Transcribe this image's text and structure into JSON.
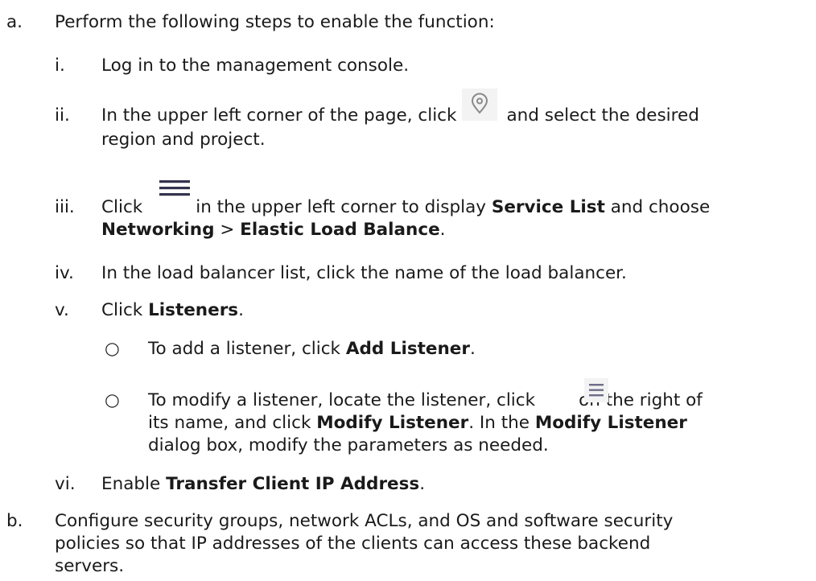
{
  "step_a": {
    "marker": "a.",
    "text": "Perform the following steps to enable the function:",
    "substeps": {
      "i": {
        "marker": "i.",
        "text": "Log in to the management console."
      },
      "ii": {
        "marker": "ii.",
        "line1_before": "In the upper left corner of the page, click",
        "line1_after": "and select the desired",
        "line2": "region and project.",
        "icon": "location-pin-icon"
      },
      "iii": {
        "marker": "iii.",
        "line1_before": "Click",
        "line1_mid": "in the upper left corner to display",
        "bold_service_list": "Service List",
        "line1_after": "and choose",
        "bold_networking": "Networking",
        "sep": ">",
        "bold_elb": "Elastic Load Balance",
        "end": ".",
        "icon": "hamburger-menu-icon"
      },
      "iv": {
        "marker": "iv.",
        "text": "In the load balancer list, click the name of the load balancer."
      },
      "v": {
        "marker": "v.",
        "before": "Click",
        "bold": "Listeners",
        "end": ".",
        "bullets": {
          "add": {
            "marker": "○",
            "before": "To add a listener, click",
            "bold": "Add Listener",
            "end": "."
          },
          "modify": {
            "marker": "○",
            "line1_before": "To modify a listener, locate the listener, click",
            "line1_after": "on the right of",
            "line2_before": "its name, and click",
            "bold_modify": "Modify Listener",
            "line2_mid": ". In the",
            "bold_modify2": "Modify Listener",
            "line3": "dialog box, modify the parameters as needed.",
            "icon": "more-menu-icon"
          }
        }
      },
      "vi": {
        "marker": "vi.",
        "before": "Enable",
        "bold": "Transfer Client IP Address",
        "end": "."
      }
    }
  },
  "step_b": {
    "marker": "b.",
    "line1": "Configure security groups, network ACLs, and OS and software security",
    "line2": "policies so that IP addresses of the clients can access these backend",
    "line3": "servers."
  }
}
